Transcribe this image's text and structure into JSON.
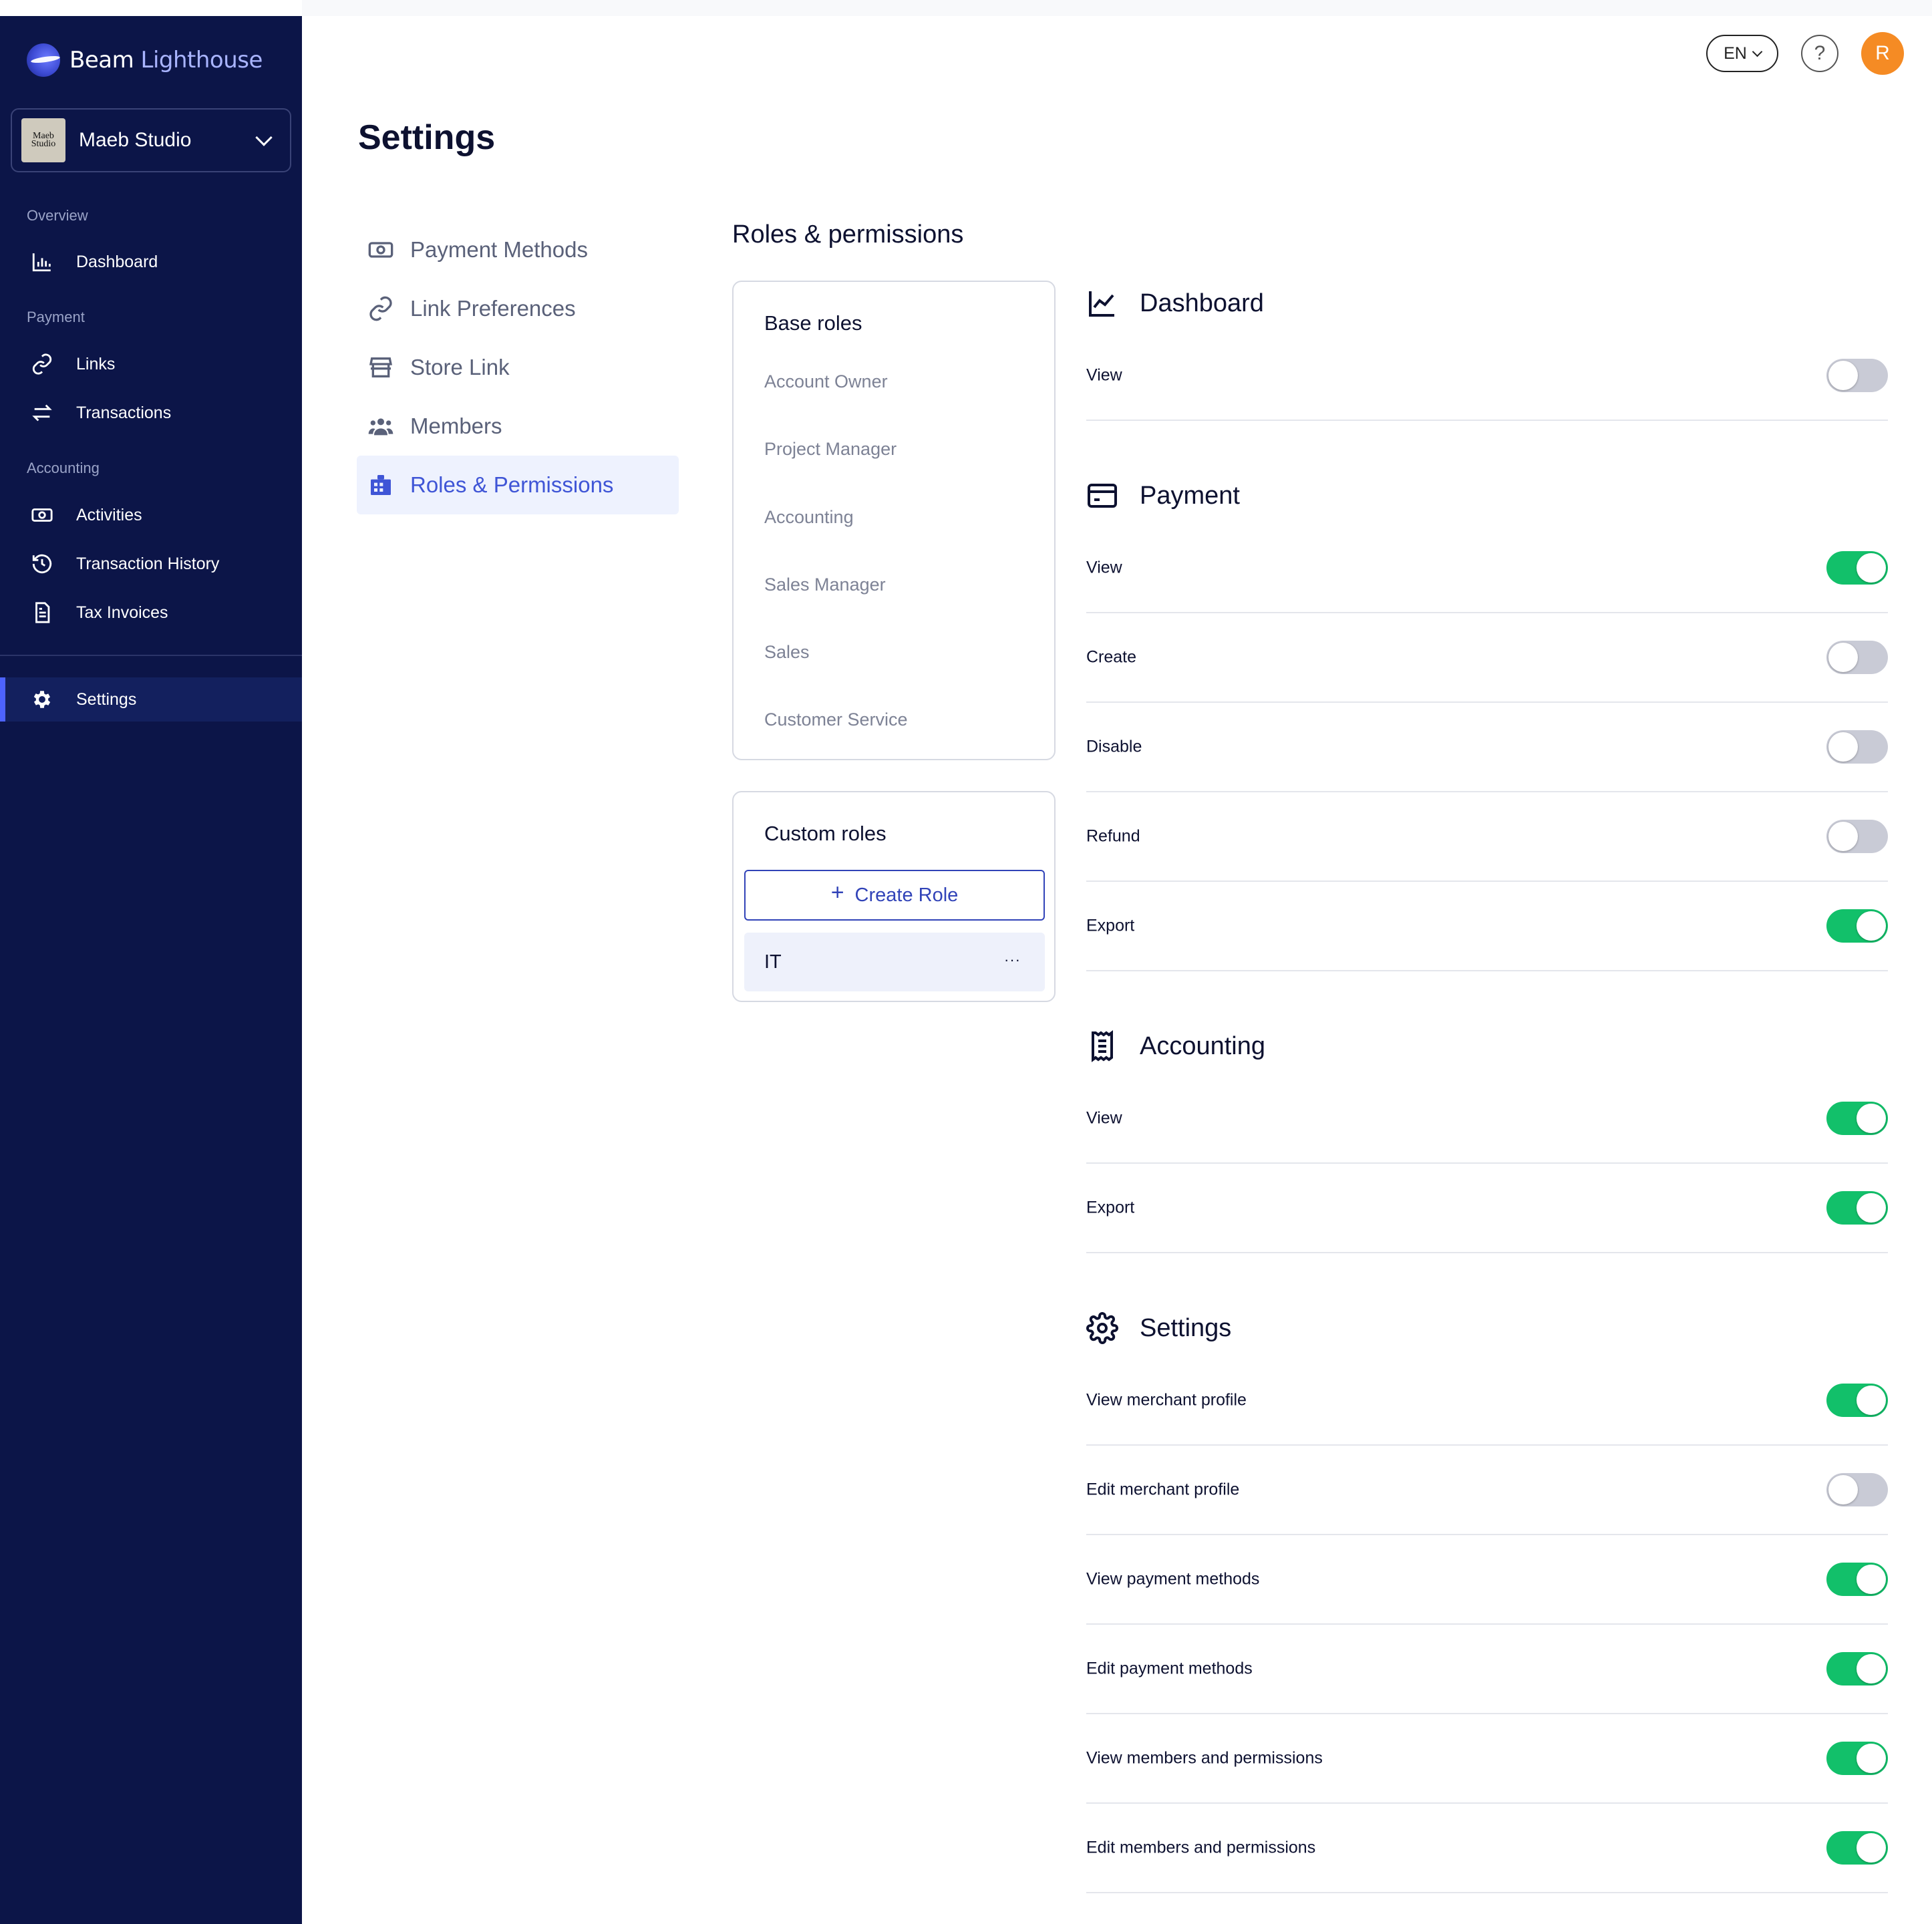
{
  "app": {
    "logo_part1": "Beam",
    "logo_part2": "Lighthouse"
  },
  "merchant": {
    "name": "Maeb Studio",
    "avatar_text": "Maeb Studio"
  },
  "sidebar": {
    "sections": [
      {
        "label": "Overview",
        "items": [
          {
            "label": "Dashboard",
            "icon": "bar-chart-icon"
          }
        ]
      },
      {
        "label": "Payment",
        "items": [
          {
            "label": "Links",
            "icon": "link-icon"
          },
          {
            "label": "Transactions",
            "icon": "arrows-exchange-icon"
          }
        ]
      },
      {
        "label": "Accounting",
        "items": [
          {
            "label": "Activities",
            "icon": "cash-icon"
          },
          {
            "label": "Transaction History",
            "icon": "history-icon"
          },
          {
            "label": "Tax Invoices",
            "icon": "document-icon"
          }
        ]
      }
    ],
    "settings_label": "Settings"
  },
  "topbar": {
    "language": "EN",
    "help": "?",
    "user_initial": "R"
  },
  "page": {
    "title": "Settings"
  },
  "subnav": [
    {
      "label": "Payment Methods",
      "icon": "cash-icon",
      "active": false
    },
    {
      "label": "Link Preferences",
      "icon": "link-icon",
      "active": false
    },
    {
      "label": "Store Link",
      "icon": "store-icon",
      "active": false
    },
    {
      "label": "Members",
      "icon": "members-icon",
      "active": false
    },
    {
      "label": "Roles & Permissions",
      "icon": "roles-icon",
      "active": true
    }
  ],
  "roles": {
    "title": "Roles & permissions",
    "base_title": "Base roles",
    "base_roles": [
      "Account Owner",
      "Project Manager",
      "Accounting",
      "Sales Manager",
      "Sales",
      "Customer Service"
    ],
    "custom_title": "Custom roles",
    "create_label": "Create Role",
    "custom_roles": [
      {
        "name": "IT",
        "menu": "···"
      }
    ]
  },
  "permissions": [
    {
      "title": "Dashboard",
      "icon": "line-chart-icon",
      "items": [
        {
          "label": "View",
          "on": false
        }
      ]
    },
    {
      "title": "Payment",
      "icon": "card-icon",
      "items": [
        {
          "label": "View",
          "on": true
        },
        {
          "label": "Create",
          "on": false
        },
        {
          "label": "Disable",
          "on": false
        },
        {
          "label": "Refund",
          "on": false
        },
        {
          "label": "Export",
          "on": true
        }
      ]
    },
    {
      "title": "Accounting",
      "icon": "receipt-icon",
      "items": [
        {
          "label": "View",
          "on": true
        },
        {
          "label": "Export",
          "on": true
        }
      ]
    },
    {
      "title": "Settings",
      "icon": "gear-icon",
      "items": [
        {
          "label": "View merchant profile",
          "on": true
        },
        {
          "label": "Edit merchant profile",
          "on": false
        },
        {
          "label": "View payment methods",
          "on": true
        },
        {
          "label": "Edit payment methods",
          "on": true
        },
        {
          "label": "View members and permissions",
          "on": true
        },
        {
          "label": "Edit members and permissions",
          "on": true
        }
      ]
    }
  ],
  "colors": {
    "sidebar": "#0c1548",
    "accent": "#3f55d6",
    "toggle_on": "#12c06a",
    "toggle_off": "#c9cbd6",
    "avatar": "#f58b24"
  }
}
